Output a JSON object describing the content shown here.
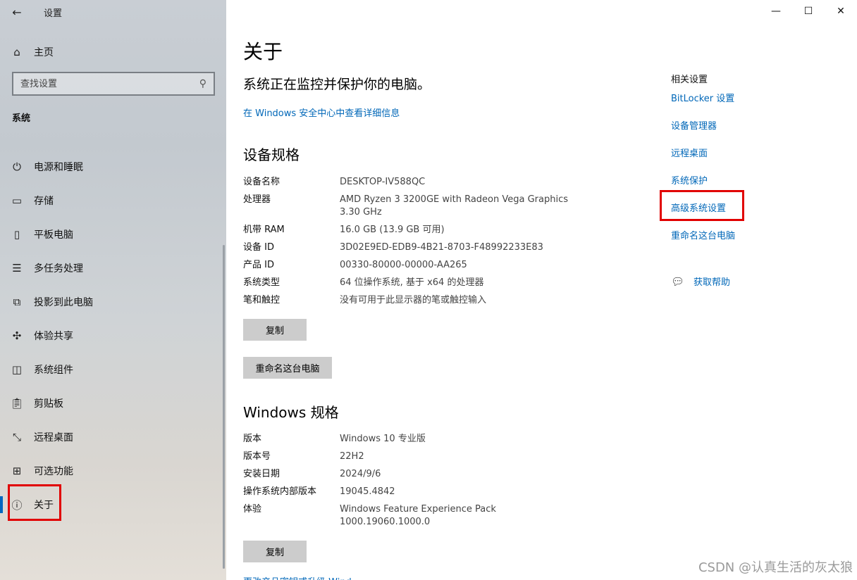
{
  "app": {
    "title": "设置",
    "back_icon": "back-arrow-icon"
  },
  "sidebar": {
    "home_label": "主页",
    "search_placeholder": "查找设置",
    "section": "系统",
    "items": [
      {
        "label": "电源和睡眠",
        "icon": "power-icon"
      },
      {
        "label": "存储",
        "icon": "storage-icon"
      },
      {
        "label": "平板电脑",
        "icon": "tablet-icon"
      },
      {
        "label": "多任务处理",
        "icon": "multitask-icon"
      },
      {
        "label": "投影到此电脑",
        "icon": "project-icon"
      },
      {
        "label": "体验共享",
        "icon": "share-icon"
      },
      {
        "label": "系统组件",
        "icon": "components-icon"
      },
      {
        "label": "剪贴板",
        "icon": "clipboard-icon"
      },
      {
        "label": "远程桌面",
        "icon": "remote-desktop-icon"
      },
      {
        "label": "可选功能",
        "icon": "optional-features-icon"
      },
      {
        "label": "关于",
        "icon": "info-icon",
        "active": true
      }
    ]
  },
  "main": {
    "title": "关于",
    "status": "系统正在监控并保护你的电脑。",
    "security_link": "在 Windows 安全中心中查看详细信息",
    "device_specs": {
      "heading": "设备规格",
      "rows": [
        {
          "key": "设备名称",
          "value": "DESKTOP-IV588QC"
        },
        {
          "key": "处理器",
          "value": "AMD Ryzen 3 3200GE with Radeon Vega Graphics\n3.30 GHz"
        },
        {
          "key": "机带 RAM",
          "value": "16.0 GB (13.9 GB 可用)"
        },
        {
          "key": "设备 ID",
          "value": "3D02E9ED-EDB9-4B21-8703-F48992233E83"
        },
        {
          "key": "产品 ID",
          "value": "00330-80000-00000-AA265"
        },
        {
          "key": "系统类型",
          "value": "64 位操作系统, 基于 x64 的处理器"
        },
        {
          "key": "笔和触控",
          "value": "没有可用于此显示器的笔或触控输入"
        }
      ],
      "copy_button": "复制",
      "rename_button": "重命名这台电脑"
    },
    "windows_specs": {
      "heading": "Windows 规格",
      "rows": [
        {
          "key": "版本",
          "value": "Windows 10 专业版"
        },
        {
          "key": "版本号",
          "value": "22H2"
        },
        {
          "key": "安装日期",
          "value": "2024/9/6"
        },
        {
          "key": "操作系统内部版本",
          "value": "19045.4842"
        },
        {
          "key": "体验",
          "value": "Windows Feature Experience Pack\n1000.19060.1000.0"
        }
      ],
      "copy_button": "复制",
      "cut_link": "更改产品密钥或升级 Wind"
    },
    "related": {
      "title": "相关设置",
      "links": [
        "BitLocker 设置",
        "设备管理器",
        "远程桌面",
        "系统保护",
        "高级系统设置",
        "重命名这台电脑"
      ],
      "help": "获取帮助"
    }
  },
  "watermark": "CSDN @认真生活的灰太狼",
  "colors": {
    "accent": "#0067b8",
    "highlight": "#e10000"
  }
}
